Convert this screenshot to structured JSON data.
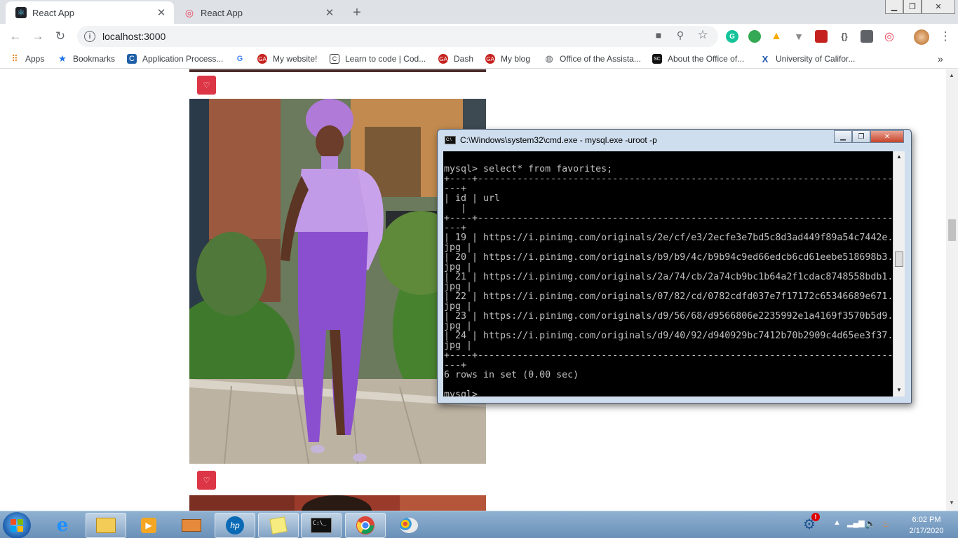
{
  "browser": {
    "tabs": [
      {
        "title": "React App",
        "active": true
      },
      {
        "title": "React App",
        "active": false
      }
    ],
    "address": "localhost:3000",
    "bookmarks": [
      "Apps",
      "Bookmarks",
      "Application Process...",
      "",
      "My website!",
      "Learn to code | Cod...",
      "Dash",
      "My blog",
      "Office of the Assista...",
      "About the Office of...",
      "University of Califor..."
    ],
    "google_bookmark_letter": "G",
    "more_bookmarks": "»"
  },
  "page": {
    "like_icon": "♡"
  },
  "cmd": {
    "title": "C:\\Windows\\system32\\cmd.exe - mysql.exe  -uroot -p",
    "lines": [
      "",
      "mysql> select* from favorites;",
      "+----+--------------------------------------------------------------------------------",
      "---+",
      "| id | url",
      "   |",
      "+----+--------------------------------------------------------------------------------",
      "---+",
      "| 19 | https://i.pinimg.com/originals/2e/cf/e3/2ecfe3e7bd5c8d3ad449f89a54c7442e.",
      "jpg |",
      "| 20 | https://i.pinimg.com/originals/b9/b9/4c/b9b94c9ed66edcb6cd61eebe518698b3.",
      "jpg |",
      "| 21 | https://i.pinimg.com/originals/2a/74/cb/2a74cb9bc1b64a2f1cdac8748558bdb1.",
      "jpg |",
      "| 22 | https://i.pinimg.com/originals/07/82/cd/0782cdfd037e7f17172c65346689e671.",
      "jpg |",
      "| 23 | https://i.pinimg.com/originals/d9/56/68/d9566806e2235992e1a4169f3570b5d9.",
      "jpg |",
      "| 24 | https://i.pinimg.com/originals/d9/40/92/d940929bc7412b70b2909c4d65ee3f37.",
      "jpg |",
      "+----+--------------------------------------------------------------------------------",
      "---+",
      "6 rows in set (0.00 sec)",
      "",
      "mysql> _"
    ]
  },
  "taskbar": {
    "time": "6:02 PM",
    "date": "2/17/2020",
    "ie_letter": "e",
    "hp_label": "hp"
  },
  "colors": {
    "like_button": "#dc3545",
    "tabstrip": "#dee1e6",
    "console_bg": "#000000",
    "console_text": "#c0c0c0"
  }
}
